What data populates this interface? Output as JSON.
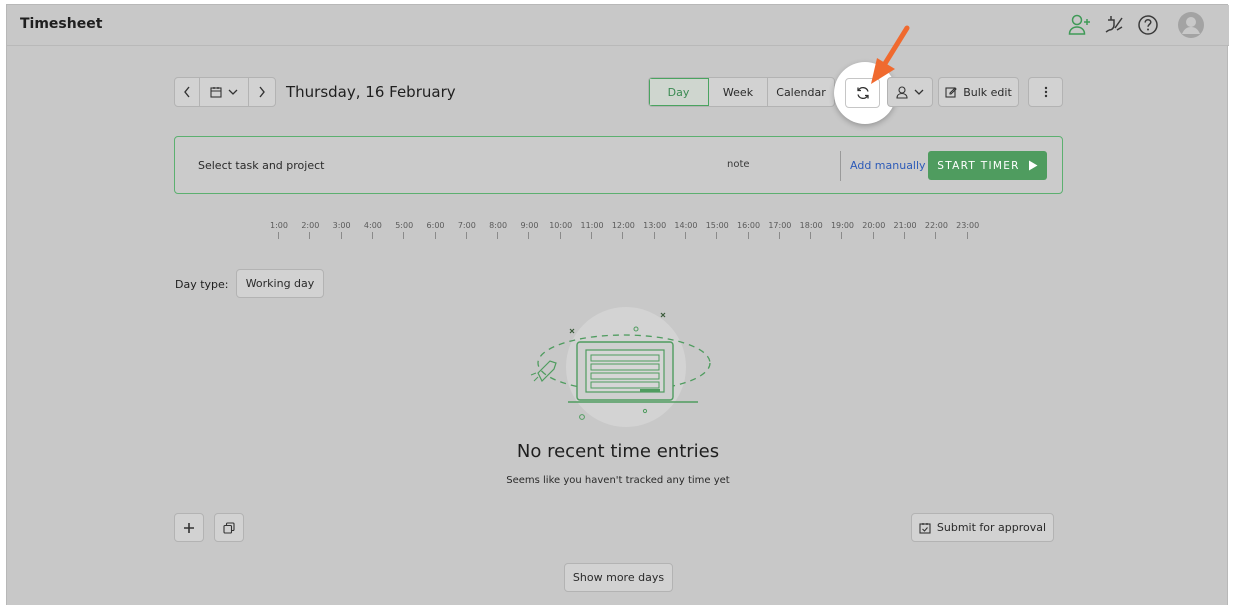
{
  "header": {
    "title": "Timesheet"
  },
  "toolbar": {
    "date": "Thursday, 16 February",
    "views": [
      "Day",
      "Week",
      "Calendar"
    ],
    "bulk_edit": "Bulk edit"
  },
  "timer": {
    "task_placeholder": "Select task and project",
    "note_placeholder": "note",
    "add_manually": "Add manually",
    "start": "START TIMER"
  },
  "timeline": {
    "hours": [
      "1:00",
      "2:00",
      "3:00",
      "4:00",
      "5:00",
      "6:00",
      "7:00",
      "8:00",
      "9:00",
      "10:00",
      "11:00",
      "12:00",
      "13:00",
      "14:00",
      "15:00",
      "16:00",
      "17:00",
      "18:00",
      "19:00",
      "20:00",
      "21:00",
      "22:00",
      "23:00"
    ]
  },
  "day_type": {
    "label": "Day type:",
    "value": "Working day"
  },
  "empty": {
    "title": "No recent time entries",
    "subtitle": "Seems like you haven't tracked any time yet"
  },
  "actions": {
    "submit": "Submit for approval",
    "show_more": "Show more days"
  },
  "colors": {
    "accent_green": "#4f9c5f",
    "link_blue": "#2d5bb8",
    "arrow": "#f06a2f"
  }
}
